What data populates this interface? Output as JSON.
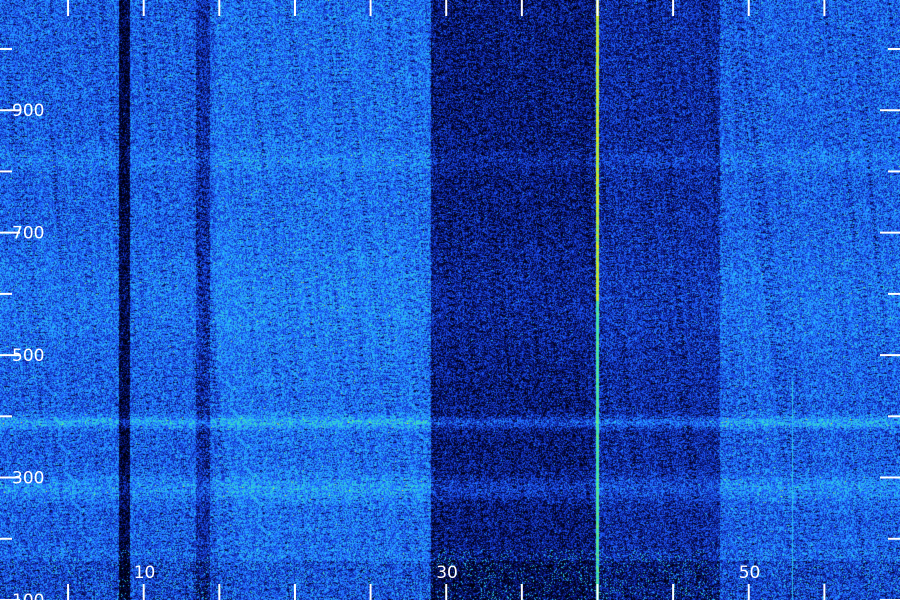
{
  "chart_data": {
    "type": "heatmap",
    "title": "",
    "xlabel": "",
    "ylabel": "",
    "x_tick_labels": [
      "10",
      "30",
      "50"
    ],
    "x_tick_values": [
      10,
      30,
      50
    ],
    "y_tick_labels": [
      "900",
      "700",
      "500",
      "300",
      "100"
    ],
    "y_tick_values": [
      900,
      700,
      500,
      300,
      100
    ],
    "xlim": [
      0.5,
      60
    ],
    "ylim": [
      100,
      1080
    ],
    "colormap": [
      "#000010",
      "#0a1a8c",
      "#1f5cff",
      "#28b4ff",
      "#3ce6b4",
      "#ffe600"
    ],
    "grid": false,
    "legend": "none"
  }
}
